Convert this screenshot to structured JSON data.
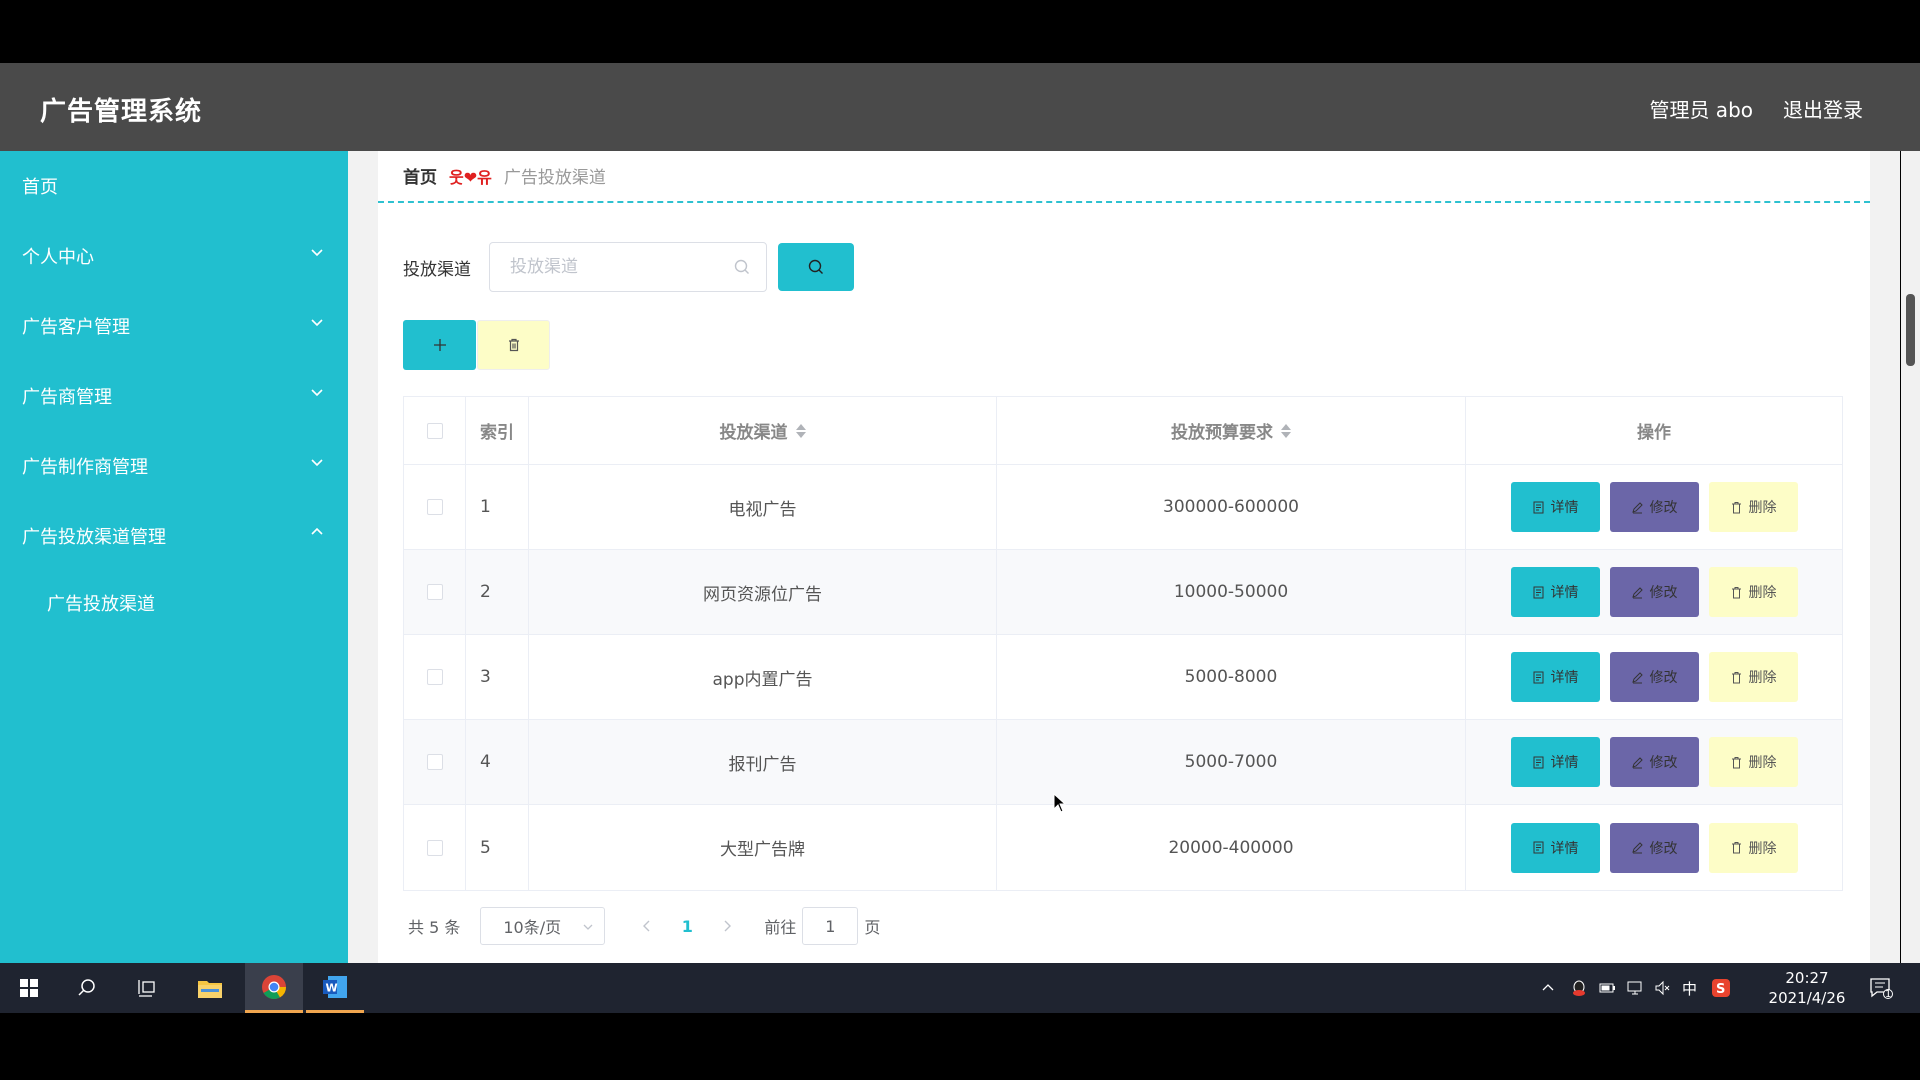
{
  "header": {
    "title": "广告管理系统",
    "user": "管理员 abo",
    "logout": "退出登录"
  },
  "sidebar": {
    "items": [
      {
        "label": "首页"
      },
      {
        "label": "个人中心"
      },
      {
        "label": "广告客户管理"
      },
      {
        "label": "广告商管理"
      },
      {
        "label": "广告制作商管理"
      },
      {
        "label": "广告投放渠道管理"
      },
      {
        "label": "广告投放渠道"
      }
    ]
  },
  "breadcrumb": {
    "home": "首页",
    "separator": "웃❤유",
    "current": "广告投放渠道"
  },
  "search": {
    "label": "投放渠道",
    "placeholder": "投放渠道",
    "value": ""
  },
  "table": {
    "columns": [
      "索引",
      "投放渠道",
      "投放预算要求",
      "操作"
    ],
    "rows": [
      {
        "index": "1",
        "channel": "电视广告",
        "budget": "300000-600000"
      },
      {
        "index": "2",
        "channel": "网页资源位广告",
        "budget": "10000-50000"
      },
      {
        "index": "3",
        "channel": "app内置广告",
        "budget": "5000-8000"
      },
      {
        "index": "4",
        "channel": "报刊广告",
        "budget": "5000-7000"
      },
      {
        "index": "5",
        "channel": "大型广告牌",
        "budget": "20000-400000"
      }
    ],
    "actions": {
      "detail": "详情",
      "edit": "修改",
      "delete": "删除"
    }
  },
  "pagination": {
    "total": "共 5 条",
    "page_size": "10条/页",
    "current_page": "1",
    "goto_label": "前往",
    "goto_value": "1",
    "page_suffix": "页"
  },
  "taskbar": {
    "tray_ime": "中",
    "time": "20:27",
    "date": "2021/4/26",
    "notification_count": "1"
  },
  "colors": {
    "accent": "#21bfcf",
    "header_bg": "#4a4a4a",
    "edit_btn": "#6b66a8",
    "delete_btn": "#fdfdc7"
  }
}
